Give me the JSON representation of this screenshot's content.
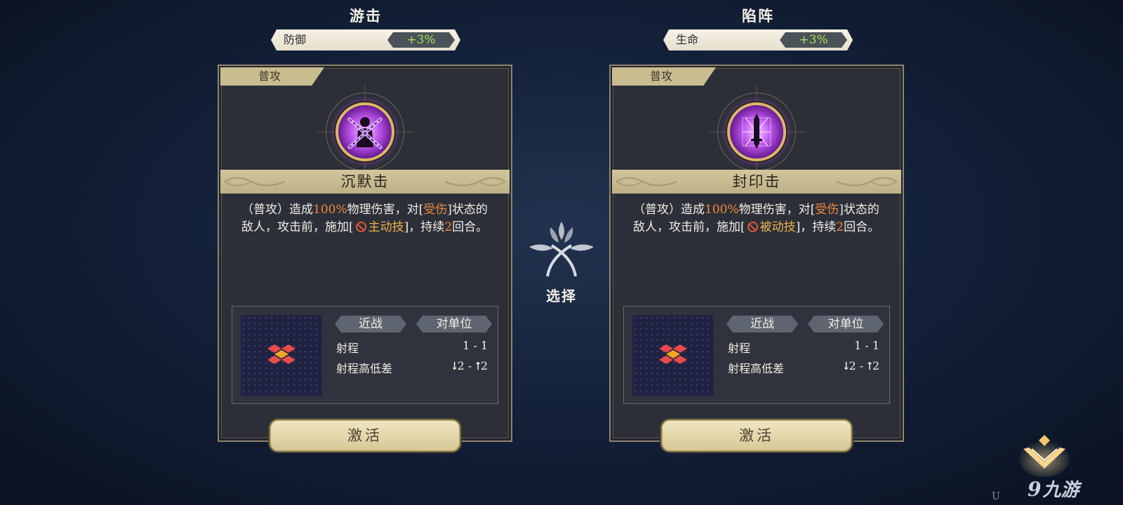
{
  "select_label": "选择",
  "watermark": {
    "glyph": "9",
    "text": "九游"
  },
  "corner_char": "U",
  "colors": {
    "stat_positive": "#a6e05a",
    "highlight_orange": "#f08a3c",
    "highlight_gold": "#f0b34a",
    "banner": "#c9bc8f"
  },
  "cards": [
    {
      "class_name": "游击",
      "stat": {
        "label": "防御",
        "value": "+3%"
      },
      "type": "普攻",
      "icon": "silenced-figure-chains-icon",
      "skill_name": "沉默击",
      "desc": {
        "p1": "（普攻）造成",
        "pct": "100%",
        "p2": "物理伤害，对[",
        "status": "受伤",
        "p3": "]状态的敌人，攻击前，施加[",
        "debuff": "主动技",
        "p4": "]，持续",
        "turns": "2",
        "p5": "回合。"
      },
      "tags": [
        "近战",
        "对单位"
      ],
      "range_label": "射程",
      "range_value": "1 - 1",
      "height_label": "射程高低差",
      "height_value": "⭣2 - ⭡2",
      "activate": "激活"
    },
    {
      "class_name": "陷阵",
      "stat": {
        "label": "生命",
        "value": "+3%"
      },
      "type": "普攻",
      "icon": "sealed-sword-icon",
      "skill_name": "封印击",
      "desc": {
        "p1": "（普攻）造成",
        "pct": "100%",
        "p2": "物理伤害，对[",
        "status": "受伤",
        "p3": "]状态的敌人，攻击前，施加[",
        "debuff": "被动技",
        "p4": "]，持续",
        "turns": "2",
        "p5": "回合。"
      },
      "tags": [
        "近战",
        "对单位"
      ],
      "range_label": "射程",
      "range_value": "1 - 1",
      "height_label": "射程高低差",
      "height_value": "⭣2 - ⭡2",
      "activate": "激活"
    }
  ]
}
